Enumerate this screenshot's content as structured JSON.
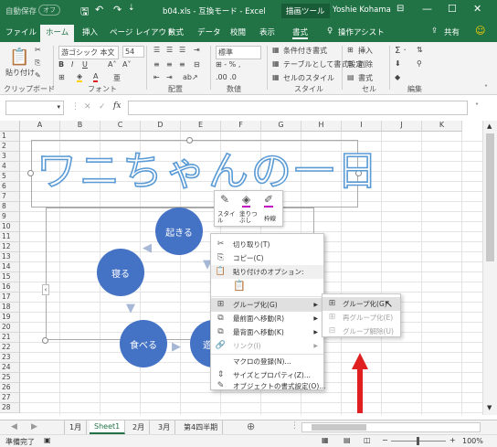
{
  "titlebar": {
    "autosave": "自動保存",
    "autosave_state": "オフ",
    "filename": "b04.xls - 互換モード - Excel",
    "tool_context": "描画ツール",
    "user": "Yoshie Kohama"
  },
  "tabs": [
    "ファイル",
    "ホーム",
    "挿入",
    "ページ レイアウト",
    "数式",
    "データ",
    "校閲",
    "表示",
    "書式"
  ],
  "tell_me": "操作アシスト",
  "share": "共有",
  "ribbon": {
    "paste_label": "貼り付け",
    "font_name": "游ゴシック 本文",
    "font_size": "54",
    "number_format": "標準",
    "cond_format": "条件付き書式",
    "table_format": "テーブルとして書式設定",
    "cell_style": "セルのスタイル",
    "insert": "挿入",
    "delete": "削除",
    "format": "書式",
    "groups": [
      "クリップボード",
      "フォント",
      "配置",
      "数値",
      "スタイル",
      "セル",
      "編集"
    ]
  },
  "formula_bar": {
    "name_box": "",
    "fx": "fx",
    "content": ""
  },
  "columns": [
    "A",
    "B",
    "C",
    "D",
    "E",
    "F",
    "G",
    "H",
    "I",
    "J",
    "K"
  ],
  "rows": [
    "1",
    "2",
    "3",
    "4",
    "5",
    "6",
    "7",
    "8",
    "9",
    "10",
    "11",
    "12",
    "13",
    "14",
    "15",
    "16",
    "17",
    "18",
    "19",
    "20",
    "21",
    "22",
    "23",
    "24",
    "25",
    "26",
    "27",
    "28"
  ],
  "wordart": "ワニちゃんの一日",
  "diagram": {
    "nodes": [
      "起きる",
      "寝る",
      "食べる",
      "遊"
    ]
  },
  "mini_toolbar": {
    "style": "スタイル",
    "fill": "塗りつぶし",
    "outline": "枠線"
  },
  "context_menu": [
    {
      "icon": "scissors",
      "label": "切り取り(T)",
      "state": "normal"
    },
    {
      "icon": "copy",
      "label": "コピー(C)",
      "state": "normal"
    },
    {
      "icon": "paste",
      "label": "貼り付けのオプション:",
      "state": "normal"
    },
    {
      "icon": "group",
      "label": "グループ化(G)",
      "state": "highlight",
      "submenu": true
    },
    {
      "icon": "front",
      "label": "最前面へ移動(R)",
      "state": "normal",
      "submenu": true
    },
    {
      "icon": "back",
      "label": "最背面へ移動(K)",
      "state": "normal",
      "submenu": true
    },
    {
      "icon": "link",
      "label": "リンク(I)",
      "state": "disabled",
      "submenu": true
    },
    {
      "icon": "macro",
      "label": "マクロの登録(N)...",
      "state": "normal"
    },
    {
      "icon": "size",
      "label": "サイズとプロパティ(Z)...",
      "state": "normal"
    },
    {
      "icon": "format",
      "label": "オブジェクトの書式設定(O)...",
      "state": "normal"
    }
  ],
  "submenu": [
    {
      "label": "グループ化(G)",
      "state": "highlight"
    },
    {
      "label": "再グループ化(E)",
      "state": "disabled"
    },
    {
      "label": "グループ解除(U)",
      "state": "disabled"
    }
  ],
  "sheets": [
    "1月",
    "Sheet1",
    "2月",
    "3月",
    "第4四半期"
  ],
  "active_sheet": "Sheet1",
  "status": {
    "ready": "準備完了",
    "zoom": "100%"
  },
  "colors": {
    "excel_green": "#217346",
    "shape_blue": "#4472c4",
    "wordart_blue": "#5b9bd5",
    "annotation_red": "#e02020"
  }
}
